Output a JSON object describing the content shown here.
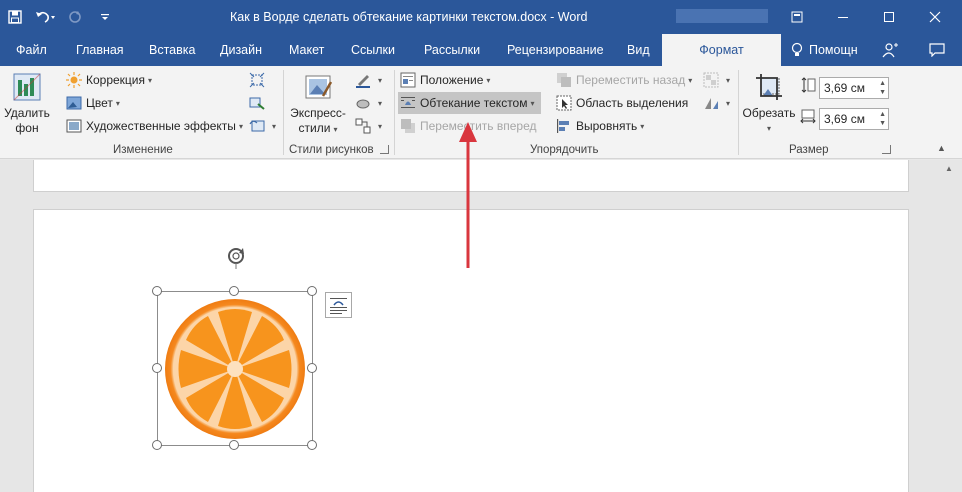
{
  "titlebar": {
    "title": "Как в Ворде сделать обтекание картинки текстом.docx - Word",
    "qat": [
      "save-icon",
      "undo-icon",
      "redo-icon",
      "customize-qat-icon"
    ]
  },
  "tabs": {
    "file": "Файл",
    "home": "Главная",
    "insert": "Вставка",
    "design": "Дизайн",
    "layout": "Макет",
    "references": "Ссылки",
    "mailings": "Рассылки",
    "review": "Рецензирование",
    "view": "Вид",
    "format": "Формат",
    "help": "Помощн"
  },
  "ribbon": {
    "remove_bg": {
      "line1": "Удалить",
      "line2": "фон"
    },
    "adjust": {
      "corrections": "Коррекция",
      "color": "Цвет",
      "artistic": "Художественные эффекты",
      "group_label": "Изменение"
    },
    "styles": {
      "quick_styles_line1": "Экспресс-",
      "quick_styles_line2": "стили",
      "group_label": "Стили рисунков"
    },
    "arrange": {
      "position": "Положение",
      "wrap_text": "Обтекание текстом",
      "bring_forward": "Переместить вперед",
      "send_backward": "Переместить назад",
      "selection_pane": "Область выделения",
      "align": "Выровнять",
      "group_label": "Упорядочить"
    },
    "size": {
      "crop": "Обрезать",
      "height": "3,69 см",
      "width": "3,69 см",
      "group_label": "Размер"
    }
  },
  "colors": {
    "brand": "#2b579a",
    "arrow": "#d9363e",
    "orange": "#f7941d"
  }
}
